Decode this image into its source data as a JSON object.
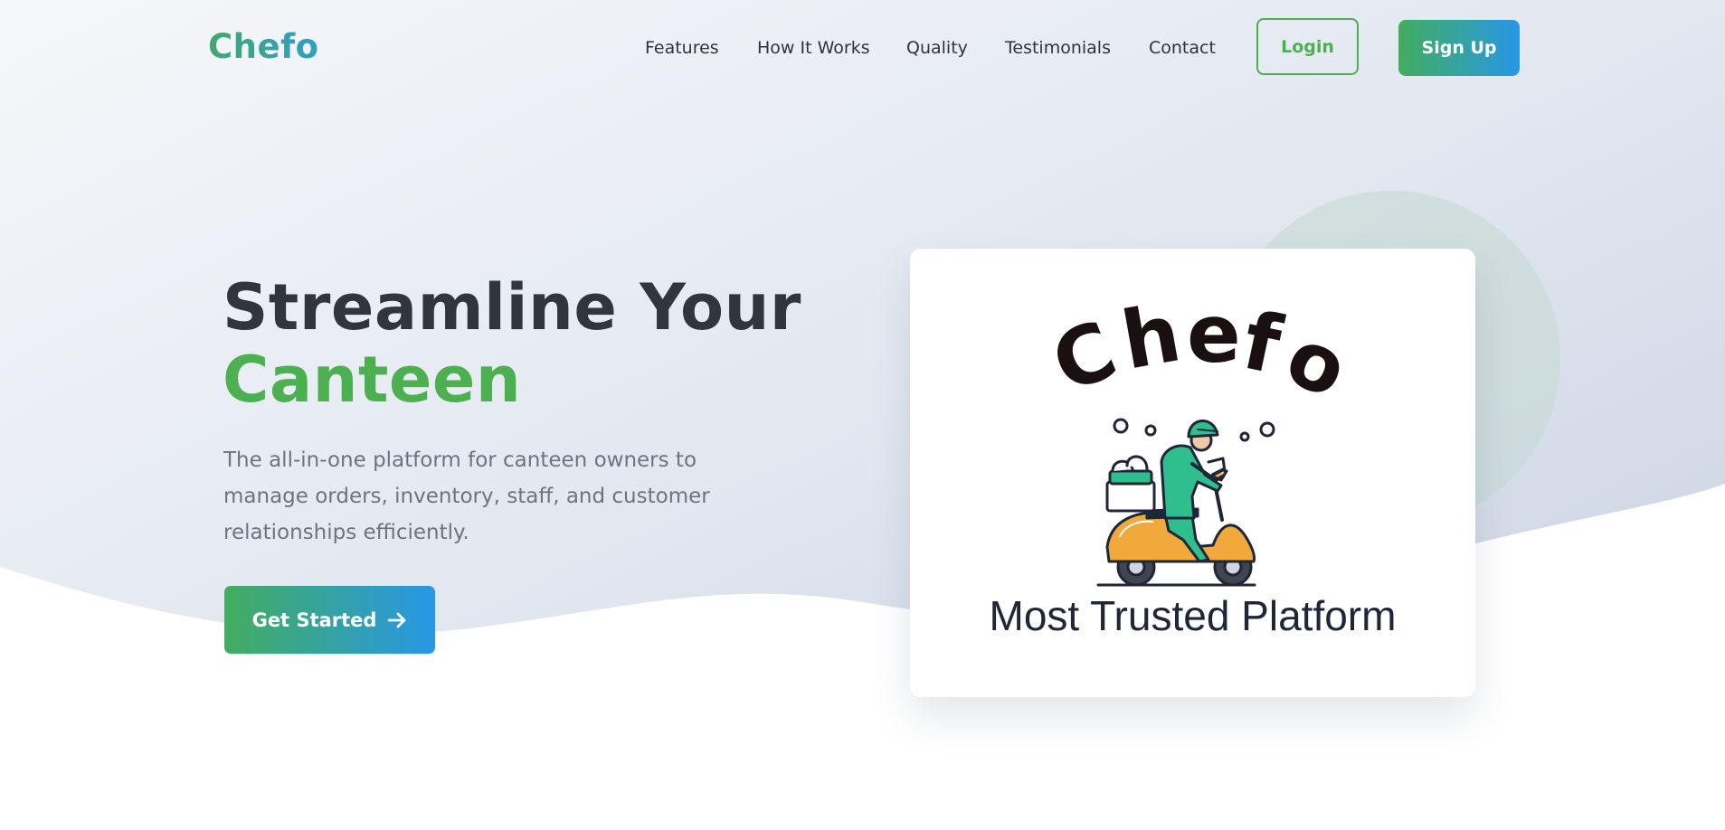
{
  "brand": {
    "logo_text": "Chefo",
    "accent_green": "#4caf50",
    "accent_blue": "#2897e6",
    "text_dark": "#31363d"
  },
  "nav": {
    "links": [
      {
        "label": "Features"
      },
      {
        "label": "How It Works"
      },
      {
        "label": "Quality"
      },
      {
        "label": "Testimonials"
      },
      {
        "label": "Contact"
      }
    ],
    "login_label": "Login",
    "signup_label": "Sign Up"
  },
  "hero": {
    "title_line1": "Streamline Your",
    "title_line2": "Canteen",
    "subtitle": "The all-in-one platform for canteen owners to manage orders, inventory, staff, and customer relationships efficiently.",
    "cta_label": "Get Started",
    "cta_icon": "arrow-right-icon"
  },
  "card": {
    "logo_text": "Chefo",
    "illustration": "delivery-rider-scooter-icon",
    "caption": "Most Trusted Platform"
  }
}
